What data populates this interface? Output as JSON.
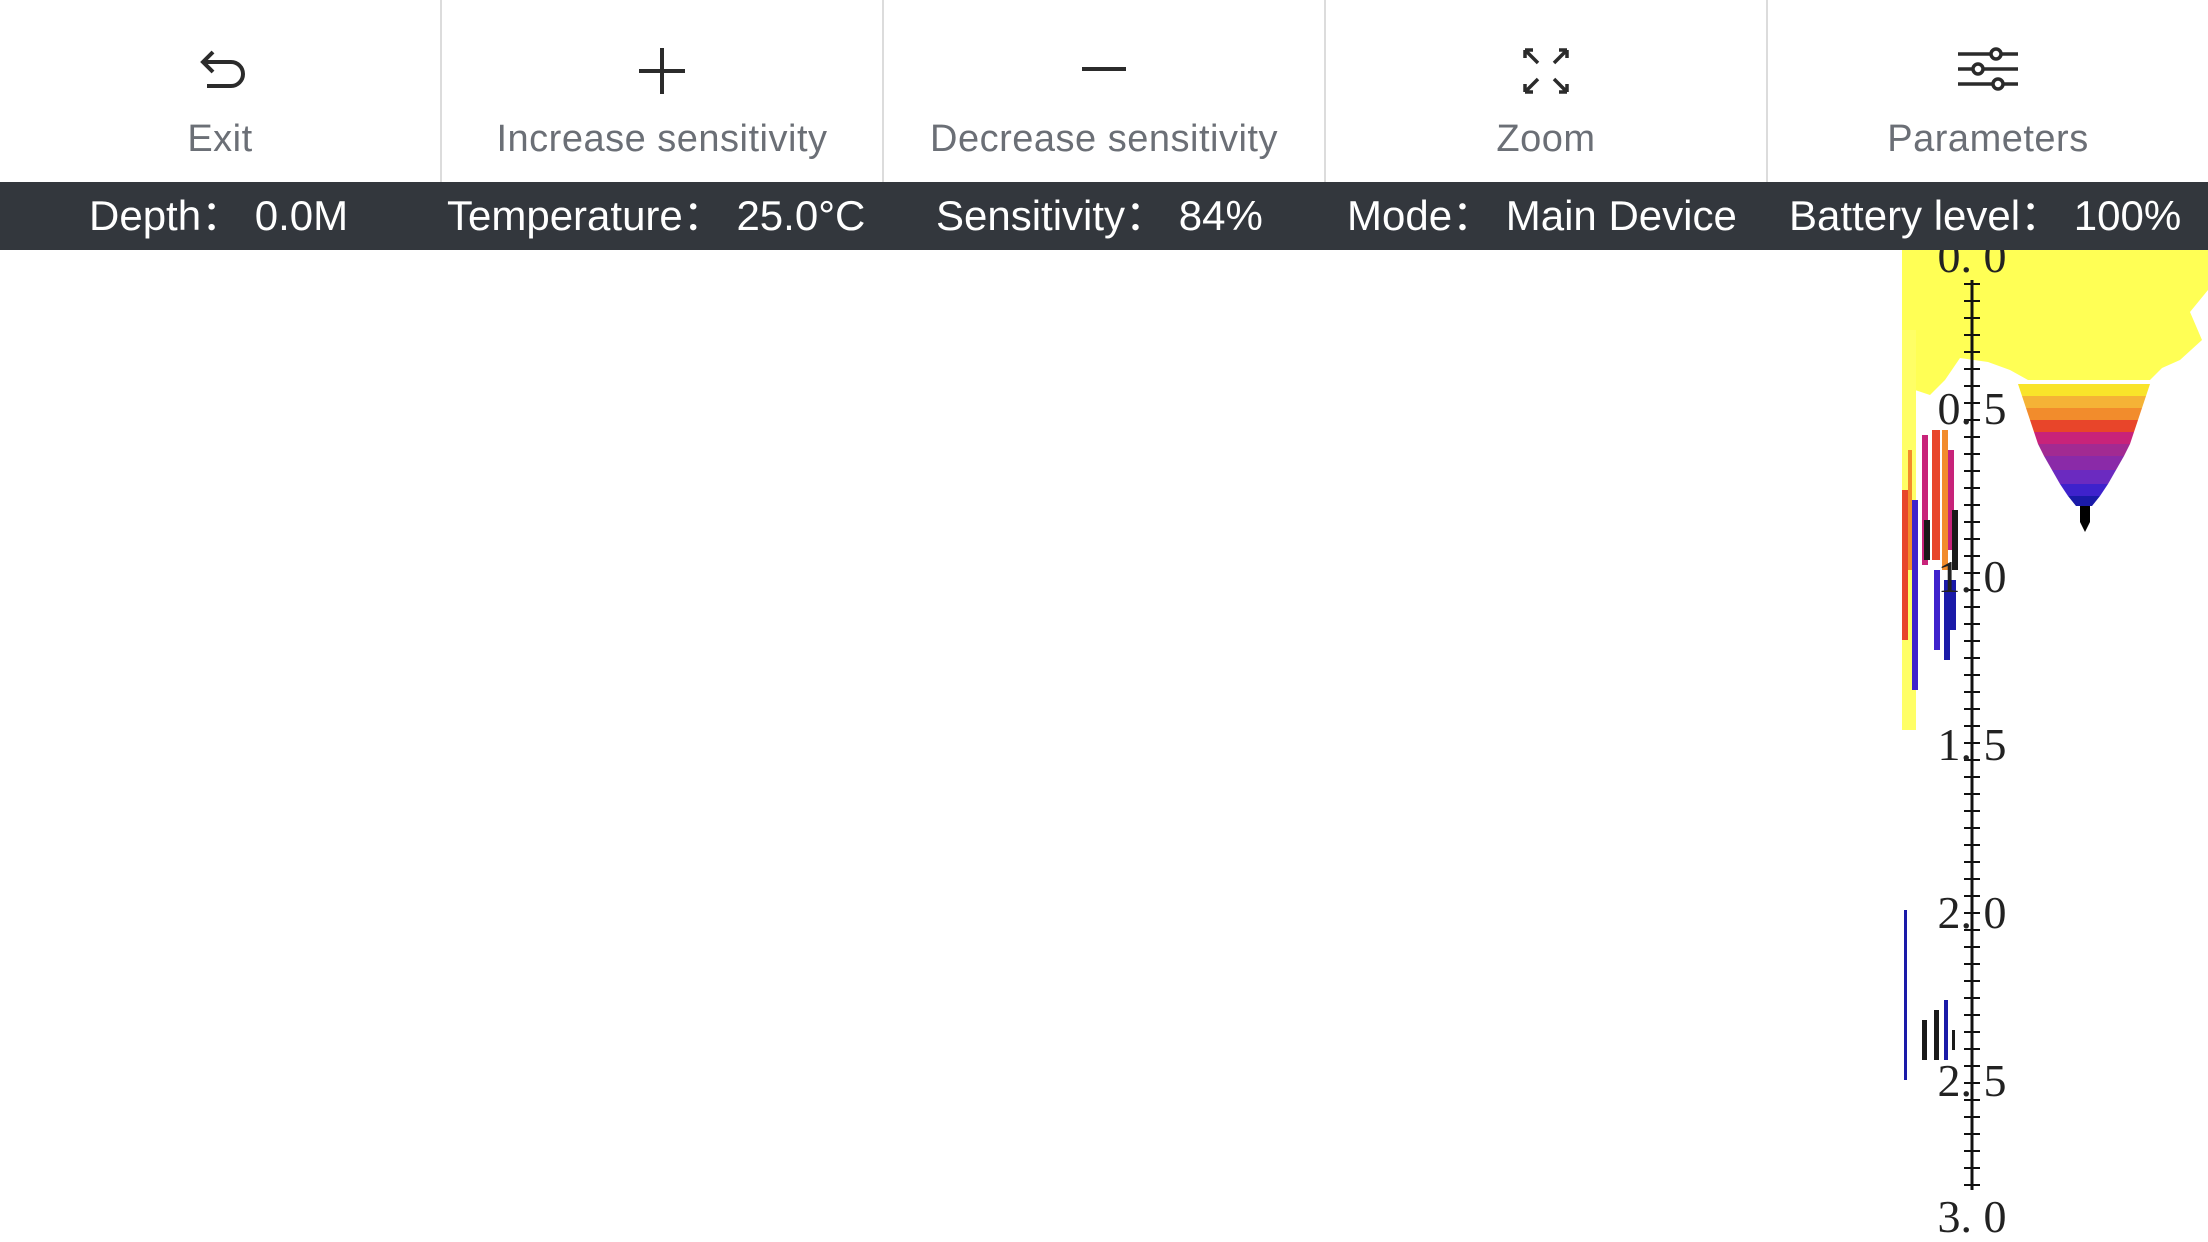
{
  "toolbar": {
    "items": [
      {
        "id": "exit",
        "label": "Exit",
        "icon": "undo-arrow-icon"
      },
      {
        "id": "increase",
        "label": "Increase sensitivity",
        "icon": "plus-icon"
      },
      {
        "id": "decrease",
        "label": "Decrease sensitivity",
        "icon": "minus-icon"
      },
      {
        "id": "zoom",
        "label": "Zoom",
        "icon": "expand-arrows-icon"
      },
      {
        "id": "parameters",
        "label": "Parameters",
        "icon": "sliders-icon"
      }
    ],
    "colors": {
      "label": "#6b6f76",
      "divider": "#dcdcdc",
      "icon": "#2b2b2b"
    }
  },
  "status": {
    "depth": {
      "label": "Depth：",
      "value": "0.0M"
    },
    "temperature": {
      "label": "Temperature：",
      "value": "25.0°C"
    },
    "sensitivity": {
      "label": "Sensitivity：",
      "value": "84%"
    },
    "mode": {
      "label": "Mode：",
      "value": "Main Device"
    },
    "battery": {
      "label": "Battery level：",
      "value": "100%"
    },
    "background": "#33373d"
  },
  "depth_scale": {
    "ticks": [
      "0. 0",
      "0. 5",
      "1. 0",
      "1. 5",
      "2. 0",
      "2. 5",
      "3. 0"
    ],
    "range": [
      0.0,
      3.0
    ]
  },
  "chart_data": {
    "type": "heatmap",
    "title": "",
    "ylabel": "",
    "ylim": [
      0.0,
      3.0
    ],
    "y_ticks": [
      0.0,
      0.5,
      1.0,
      1.5,
      2.0,
      2.5,
      3.0
    ],
    "colors": [
      "#ffff55",
      "#f9e42a",
      "#f28c2c",
      "#e8452a",
      "#c8237a",
      "#8a2aa8",
      "#3e22cc",
      "#1a1aa8",
      "#000000"
    ]
  }
}
